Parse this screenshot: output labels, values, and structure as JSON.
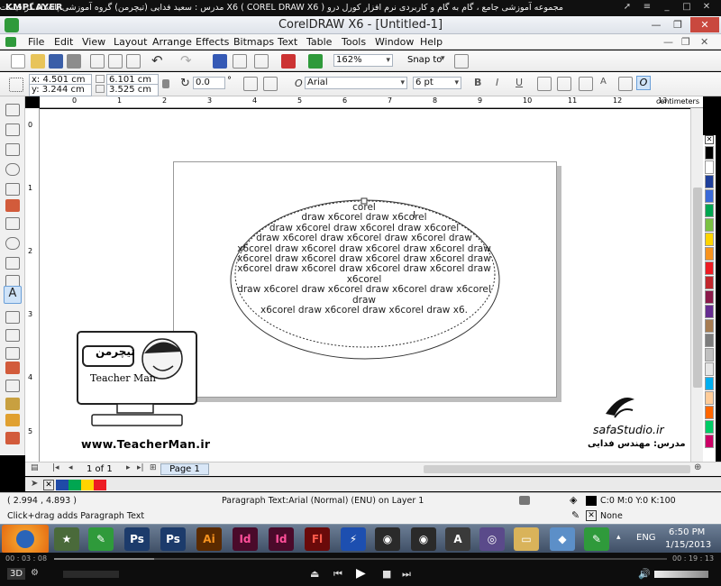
{
  "player": {
    "logo": "KMPLAYER",
    "title": "مجموعه آموزشی جامع ، گام به گام و کاربردی نرم افزار کورل درو X6 ( COREL DRAW X6 ) مدرس : سعید فدایی (تیچرمن) گروه آموزشی پادشاه گرافیست ها",
    "time_elapsed": "00 : 03 : 08",
    "time_total": "00 : 19 : 13"
  },
  "window": {
    "title": "CorelDRAW X6 - [Untitled-1]"
  },
  "menu": [
    "File",
    "Edit",
    "View",
    "Layout",
    "Arrange",
    "Effects",
    "Bitmaps",
    "Text",
    "Table",
    "Tools",
    "Window",
    "Help"
  ],
  "standard_toolbar": {
    "zoom": "162%",
    "snap_to": "Snap to"
  },
  "property_bar": {
    "x": "x: 4.501 cm",
    "y": "y: 3.244 cm",
    "width": "6.101 cm",
    "height": "3.525 cm",
    "angle": "0.0",
    "degree": "°",
    "font": "Arial",
    "font_size": "6 pt"
  },
  "ruler": {
    "units": "centimeters",
    "h_ticks": [
      "0",
      "1",
      "2",
      "3",
      "4",
      "5",
      "6",
      "7",
      "8",
      "9",
      "10",
      "11",
      "12",
      "13"
    ],
    "v_ticks": [
      "0",
      "1",
      "2",
      "3",
      "4",
      "5"
    ]
  },
  "paragraph_text": [
    "corel",
    "draw x6corel draw x6corel",
    "draw x6corel draw x6corel draw x6corel",
    "draw x6corel draw x6corel draw x6corel draw",
    "x6corel draw x6corel draw x6corel draw x6corel draw",
    "x6corel draw x6corel draw x6corel draw x6corel draw",
    "x6corel draw x6corel draw x6corel draw x6corel draw x6corel",
    "draw x6corel draw x6corel draw x6corel draw x6corel draw",
    "x6corel draw x6corel draw x6corel draw x6."
  ],
  "watermark": {
    "brand_fa": "تیچرمن",
    "brand_en": "Teacher Man",
    "url": "www.TeacherMan.ir",
    "studio": "safaStudio.ir",
    "teacher_fa": "مدرس: مهندس فدایی"
  },
  "page_nav": {
    "counter": "1 of 1",
    "tab": "Page 1"
  },
  "status": {
    "coords": "( 2.994 , 4.893 )",
    "object_info": "Paragraph Text:Arial (Normal) (ENU) on Layer 1",
    "hint": "Click+drag adds Paragraph Text",
    "fill": "C:0 M:0 Y:0 K:100",
    "outline": "None"
  },
  "taskbar": {
    "apps": [
      "Ps",
      "Ps",
      "Ai",
      "Id",
      "Id",
      "Fl"
    ],
    "lang": "ENG",
    "time": "6:50 PM",
    "date": "1/15/2013"
  },
  "colors": {
    "accent_green": "#2f9a3b",
    "canvas_bg": "#ffffff",
    "taskbar": "#4d5e76"
  },
  "palette": [
    "#000000",
    "#ffffff",
    "#1f3f9a",
    "#3a6ad8",
    "#00a651",
    "#7ac143",
    "#ffd400",
    "#f7931e",
    "#ed1c24",
    "#c1272d",
    "#8b1a4a",
    "#662d91",
    "#a67c52",
    "#7d7d7d",
    "#c0c0c0",
    "#e6e6e6",
    "#00aeef",
    "#ffcc99",
    "#ff6600",
    "#00cc66",
    "#cc0066"
  ],
  "doc_palette": [
    "#1f4aa8",
    "#00a651",
    "#ffd400",
    "#ed1c24"
  ]
}
